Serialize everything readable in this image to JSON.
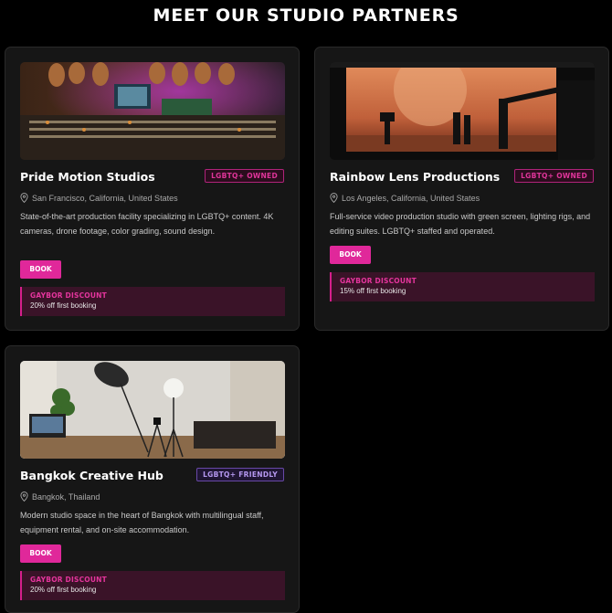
{
  "page": {
    "title": "MEET OUR STUDIO PARTNERS"
  },
  "studios": [
    {
      "name": "Pride Motion Studios",
      "badge": "LGBTQ+ OWNED",
      "location": "San Francisco, California, United States",
      "description": "State-of-the-art production facility specializing in LGBTQ+ content. 4K cameras, drone footage, color grading, sound design.",
      "book_label": "BOOK",
      "discount_label": "GAYBOR DISCOUNT",
      "discount_text": "20% off first booking",
      "image": "recording-studio-photo"
    },
    {
      "name": "Rainbow Lens Productions",
      "badge": "LGBTQ+ OWNED",
      "location": "Los Angeles, California, United States",
      "description": "Full-service video production studio with green screen, lighting rigs, and editing suites. LGBTQ+ staffed and operated.",
      "book_label": "BOOK",
      "discount_label": "GAYBOR DISCOUNT",
      "discount_text": "15% off first booking",
      "image": "film-set-photo"
    },
    {
      "name": "Bangkok Creative Hub",
      "badge": "LGBTQ+ FRIENDLY",
      "location": "Bangkok, Thailand",
      "description": "Modern studio space in the heart of Bangkok with multilingual staff, equipment rental, and on-site accommodation.",
      "book_label": "BOOK",
      "discount_label": "GAYBOR DISCOUNT",
      "discount_text": "20% off first booking",
      "image": "photo-studio-photo"
    }
  ],
  "colors": {
    "accent": "#e0289a",
    "badge_owned": "#e0359a",
    "badge_friendly": "#b598f0",
    "discount_bg": "#3a1328"
  },
  "icons": {
    "location": "map-pin-icon"
  }
}
